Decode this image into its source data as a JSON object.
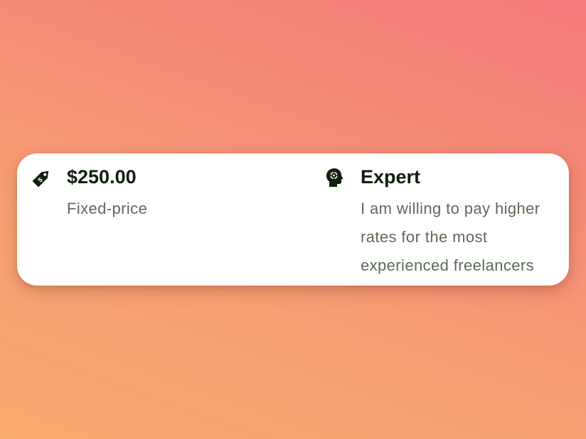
{
  "budget": {
    "icon": "price-tag-icon",
    "amount": "$250.00",
    "type": "Fixed-price"
  },
  "experience": {
    "icon": "head-gear-icon",
    "level": "Expert",
    "description": "I am willing to pay higher rates for the most experienced freelancers"
  },
  "colors": {
    "title": "#0f1f0c",
    "subtitle": "#5c6b57",
    "card": "#ffffff"
  }
}
